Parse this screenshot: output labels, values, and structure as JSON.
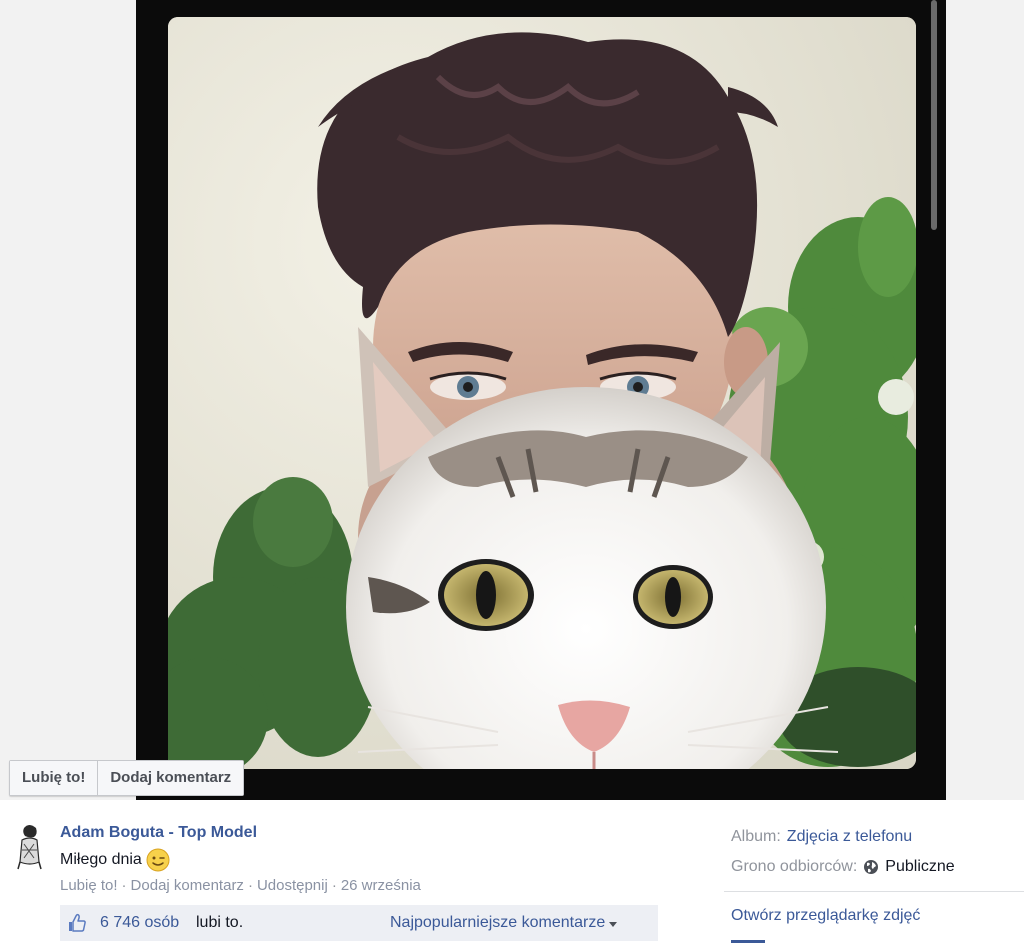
{
  "photo": {
    "alt": "",
    "colors": {
      "frame": "#0b0b0b",
      "sky": "#e6e3d6",
      "hair": "#3a2a2e",
      "skin": "#d9b7a4",
      "foliage": "#4f8a3c",
      "cat_fur": "#f4f2ef",
      "cat_eye": "#b2a35c"
    }
  },
  "actions": {
    "like_label": "Lubię to!",
    "comment_label": "Dodaj komentarz"
  },
  "post": {
    "author": "Adam Boguta - Top Model",
    "caption": "Miłego dnia",
    "caption_emoji": "wink-emoji",
    "meta": {
      "like": "Lubię to!",
      "comment": "Dodaj komentarz",
      "share": "Udostępnij",
      "date": "26 września",
      "separator": "·"
    },
    "likes": {
      "count": "6 746 osób",
      "suffix": "lubi to.",
      "sort_label": "Najpopularniejsze komentarze"
    }
  },
  "side": {
    "album_key": "Album:",
    "album_value": "Zdjęcia z telefonu",
    "audience_key": "Grono odbiorców:",
    "audience_value": "Publiczne",
    "gallery_link": "Otwórz przeglądarkę zdjęć"
  },
  "colors": {
    "link": "#3b5998",
    "muted": "#90949c",
    "text": "#141823",
    "likes_bg": "#edeff4"
  }
}
